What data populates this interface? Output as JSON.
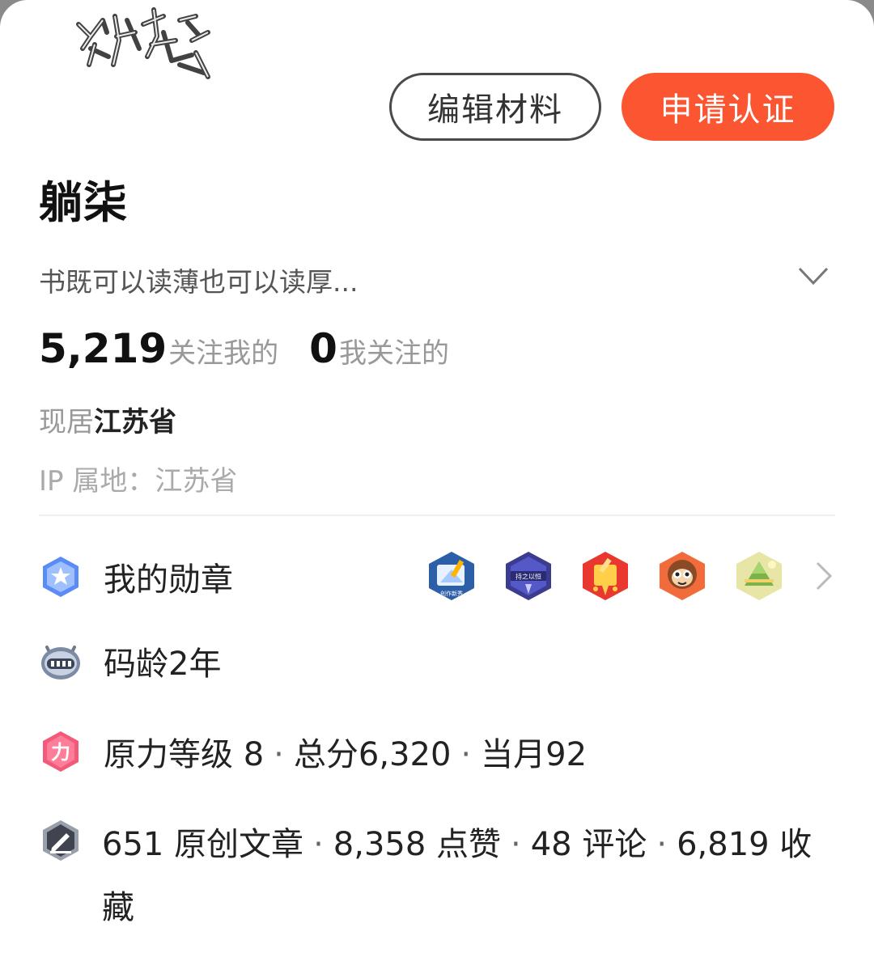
{
  "profile": {
    "username": "躺柒",
    "bio": "书既可以读薄也可以读厚...",
    "avatar_icon": "scribble-avatar-icon"
  },
  "actions": {
    "edit_label": "编辑材料",
    "certify_label": "申请认证"
  },
  "stats": {
    "followers_count": "5,219",
    "followers_label": "关注我的",
    "following_count": "0",
    "following_label": "我关注的"
  },
  "location": {
    "residence_prefix": "现居",
    "residence_value": "江苏省",
    "ip_label": "IP 属地：",
    "ip_value": "江苏省"
  },
  "badges_row": {
    "label": "我的勋章",
    "icon": "medal-star-icon",
    "badges": [
      {
        "name": "writing-badge-icon",
        "text": "创作新秀"
      },
      {
        "name": "persistence-badge-icon",
        "text": "持之以恒"
      },
      {
        "name": "pen-badge-icon",
        "text": ""
      },
      {
        "name": "monkey-badge-icon",
        "text": ""
      },
      {
        "name": "zongzi-badge-icon",
        "text": ""
      }
    ]
  },
  "code_age": {
    "label": "码龄2年",
    "icon": "robot-icon"
  },
  "force": {
    "level_label": "原力等级 8",
    "total_label": "总分6,320",
    "month_label": "当月92",
    "icon_text": "力"
  },
  "works": {
    "articles": "651 原创文章",
    "likes": "8,358 点赞",
    "comments": "48 评论",
    "favorites": "6,819 收藏",
    "icon": "edit-pen-icon"
  },
  "colors": {
    "accent": "#fc5531",
    "muted": "#999999"
  }
}
